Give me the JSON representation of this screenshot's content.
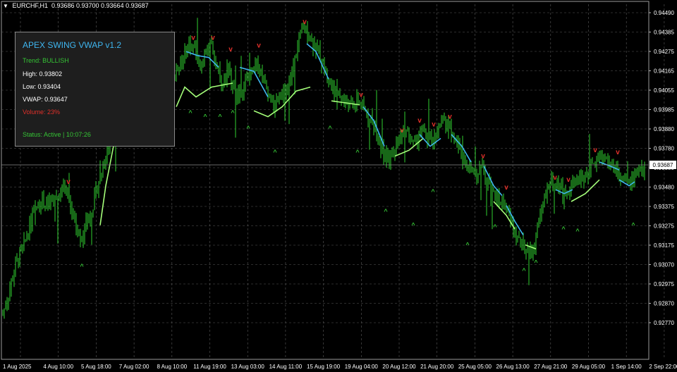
{
  "header": {
    "symbol": "EURCHF,H1",
    "ohlc": "0.93686 0.93700 0.93664 0.93687"
  },
  "panel": {
    "title": "APEX SWING VWAP v1.2",
    "trend": "Trend: BULLISH",
    "high": "High: 0.93802",
    "low": "Low: 0.93404",
    "vwap": "VWAP: 0.93647",
    "volume": "Volume: 23%",
    "status": "Status: Active | 10:07:26",
    "colors": {
      "title": "#3fb6f0",
      "trend": "#35c435",
      "text": "#ffffff",
      "volume": "#e0302a",
      "status": "#35c435",
      "bg": "#1e1e1e",
      "border": "#8a8a8a"
    }
  },
  "price_axis": {
    "labels": [
      "0.94490",
      "0.94385",
      "0.94275",
      "0.94165",
      "0.94055",
      "0.93985",
      "0.93880",
      "0.93780",
      "0.93580",
      "0.93480",
      "0.93375",
      "0.93275",
      "0.93175",
      "0.93070",
      "0.92975",
      "0.92870",
      "0.92770"
    ],
    "current_price": "0.93687"
  },
  "time_axis": {
    "labels": [
      "1 Aug 2025",
      "4 Aug 10:00",
      "5 Aug 18:00",
      "7 Aug 02:00",
      "8 Aug 10:00",
      "11 Aug 19:00",
      "13 Aug 03:00",
      "14 Aug 11:00",
      "15 Aug 19:00",
      "19 Aug 04:00",
      "20 Aug 12:00",
      "21 Aug 20:00",
      "25 Aug 05:00",
      "26 Aug 13:00",
      "27 Aug 21:00",
      "29 Aug 05:00",
      "1 Sep 14:00",
      "2 Sep 22:00"
    ]
  },
  "chart_data": {
    "type": "candlestick",
    "symbol": "EURCHF",
    "timeframe": "H1",
    "ylim": [
      0.9272,
      0.9452
    ],
    "current_price": 0.93687,
    "grid": true,
    "colors": {
      "candles": "#2fd12f",
      "vwap_up": "#3fb6f0",
      "vwap_down": "#a5ff7a",
      "sell_signal": "#e0302a",
      "buy_signal": "#35c435",
      "background": "#000000",
      "grid": "#5a5a5a"
    },
    "close_path": [
      [
        0,
        0.929
      ],
      [
        12,
        0.9305
      ],
      [
        22,
        0.932
      ],
      [
        34,
        0.933
      ],
      [
        46,
        0.9345
      ],
      [
        58,
        0.9352
      ],
      [
        70,
        0.935
      ],
      [
        82,
        0.9355
      ],
      [
        92,
        0.936
      ],
      [
        100,
        0.9348
      ],
      [
        108,
        0.934
      ],
      [
        116,
        0.9332
      ],
      [
        124,
        0.9342
      ],
      [
        132,
        0.935
      ],
      [
        140,
        0.9362
      ],
      [
        148,
        0.9372
      ],
      [
        156,
        0.9382
      ],
      [
        164,
        0.939
      ],
      [
        172,
        0.9396
      ],
      [
        180,
        0.94
      ],
      [
        188,
        0.9398
      ],
      [
        196,
        0.9405
      ],
      [
        204,
        0.9408
      ],
      [
        212,
        0.941
      ],
      [
        220,
        0.9412
      ],
      [
        228,
        0.941
      ],
      [
        236,
        0.9405
      ],
      [
        244,
        0.9412
      ],
      [
        252,
        0.942
      ],
      [
        260,
        0.9425
      ],
      [
        268,
        0.9432
      ],
      [
        276,
        0.943
      ],
      [
        284,
        0.942
      ],
      [
        292,
        0.9428
      ],
      [
        300,
        0.9432
      ],
      [
        308,
        0.942
      ],
      [
        316,
        0.9412
      ],
      [
        324,
        0.9418
      ],
      [
        332,
        0.941
      ],
      [
        340,
        0.9405
      ],
      [
        348,
        0.9412
      ],
      [
        356,
        0.9418
      ],
      [
        364,
        0.9425
      ],
      [
        372,
        0.9415
      ],
      [
        380,
        0.9408
      ],
      [
        388,
        0.94
      ],
      [
        396,
        0.9405
      ],
      [
        404,
        0.9408
      ],
      [
        412,
        0.9415
      ],
      [
        420,
        0.9428
      ],
      [
        428,
        0.9438
      ],
      [
        436,
        0.944
      ],
      [
        444,
        0.9432
      ],
      [
        452,
        0.9428
      ],
      [
        460,
        0.942
      ],
      [
        468,
        0.9412
      ],
      [
        476,
        0.9408
      ],
      [
        484,
        0.9405
      ],
      [
        492,
        0.9402
      ],
      [
        500,
        0.94
      ],
      [
        508,
        0.9403
      ],
      [
        516,
        0.9398
      ],
      [
        524,
        0.9395
      ],
      [
        532,
        0.939
      ],
      [
        540,
        0.938
      ],
      [
        548,
        0.9372
      ],
      [
        556,
        0.9375
      ],
      [
        564,
        0.9383
      ],
      [
        572,
        0.9388
      ],
      [
        580,
        0.9385
      ],
      [
        588,
        0.938
      ],
      [
        596,
        0.9388
      ],
      [
        604,
        0.9385
      ],
      [
        612,
        0.9382
      ],
      [
        620,
        0.9388
      ],
      [
        628,
        0.9393
      ],
      [
        636,
        0.939
      ],
      [
        644,
        0.9385
      ],
      [
        652,
        0.9378
      ],
      [
        660,
        0.9372
      ],
      [
        668,
        0.9368
      ],
      [
        676,
        0.9365
      ],
      [
        684,
        0.937
      ],
      [
        692,
        0.9362
      ],
      [
        700,
        0.9355
      ],
      [
        708,
        0.9352
      ],
      [
        716,
        0.935
      ],
      [
        724,
        0.9342
      ],
      [
        732,
        0.9335
      ],
      [
        740,
        0.933
      ],
      [
        748,
        0.9325
      ],
      [
        756,
        0.9328
      ],
      [
        764,
        0.934
      ],
      [
        772,
        0.9355
      ],
      [
        780,
        0.9362
      ],
      [
        788,
        0.936
      ],
      [
        796,
        0.9358
      ],
      [
        804,
        0.9355
      ],
      [
        812,
        0.936
      ],
      [
        820,
        0.9362
      ],
      [
        828,
        0.9365
      ],
      [
        836,
        0.9368
      ],
      [
        844,
        0.9372
      ],
      [
        852,
        0.9375
      ],
      [
        860,
        0.9373
      ],
      [
        868,
        0.937
      ],
      [
        876,
        0.9365
      ],
      [
        884,
        0.9362
      ],
      [
        892,
        0.9362
      ],
      [
        900,
        0.9365
      ],
      [
        908,
        0.9368
      ],
      [
        915,
        0.9369
      ]
    ],
    "vwap_segments": [
      {
        "color": "#3fb6f0",
        "points": [
          [
            264,
            0.9428
          ],
          [
            280,
            0.9426
          ],
          [
            296,
            0.9425
          ],
          [
            310,
            0.942
          ]
        ]
      },
      {
        "color": "#a5ff7a",
        "points": [
          [
            250,
            0.94
          ],
          [
            262,
            0.941
          ],
          [
            278,
            0.9405
          ],
          [
            300,
            0.941
          ],
          [
            330,
            0.9412
          ]
        ]
      },
      {
        "color": "#3fb6f0",
        "points": [
          [
            340,
            0.942
          ],
          [
            360,
            0.9418
          ],
          [
            380,
            0.9405
          ]
        ]
      },
      {
        "color": "#a5ff7a",
        "points": [
          [
            360,
            0.9398
          ],
          [
            380,
            0.9395
          ],
          [
            400,
            0.94
          ],
          [
            420,
            0.9408
          ],
          [
            440,
            0.941
          ]
        ]
      },
      {
        "color": "#3fb6f0",
        "points": [
          [
            435,
            0.9432
          ],
          [
            448,
            0.9428
          ],
          [
            466,
            0.9414
          ]
        ]
      },
      {
        "color": "#a5ff7a",
        "points": [
          [
            470,
            0.9403
          ],
          [
            490,
            0.9402
          ],
          [
            510,
            0.9401
          ]
        ]
      },
      {
        "color": "#3fb6f0",
        "points": [
          [
            515,
            0.94
          ],
          [
            530,
            0.9393
          ],
          [
            545,
            0.938
          ]
        ]
      },
      {
        "color": "#a5ff7a",
        "points": [
          [
            560,
            0.9375
          ],
          [
            580,
            0.9378
          ],
          [
            600,
            0.9384
          ]
        ]
      },
      {
        "color": "#3fb6f0",
        "points": [
          [
            595,
            0.9386
          ],
          [
            610,
            0.938
          ],
          [
            625,
            0.9384
          ]
        ]
      },
      {
        "color": "#3fb6f0",
        "points": [
          [
            640,
            0.9386
          ],
          [
            655,
            0.938
          ],
          [
            668,
            0.9372
          ]
        ]
      },
      {
        "color": "#3fb6f0",
        "points": [
          [
            686,
            0.937
          ],
          [
            700,
            0.936
          ],
          [
            712,
            0.9355
          ]
        ]
      },
      {
        "color": "#a5ff7a",
        "points": [
          [
            700,
            0.9352
          ],
          [
            718,
            0.9345
          ],
          [
            730,
            0.9338
          ]
        ]
      },
      {
        "color": "#3fb6f0",
        "points": [
          [
            718,
            0.935
          ],
          [
            730,
            0.9342
          ],
          [
            742,
            0.9335
          ]
        ]
      },
      {
        "color": "#a5ff7a",
        "points": [
          [
            745,
            0.933
          ],
          [
            760,
            0.9328
          ]
        ]
      },
      {
        "color": "#3fb6f0",
        "points": [
          [
            788,
            0.9358
          ],
          [
            800,
            0.9356
          ],
          [
            812,
            0.9358
          ]
        ]
      },
      {
        "color": "#a5ff7a",
        "points": [
          [
            810,
            0.9352
          ],
          [
            830,
            0.9356
          ],
          [
            850,
            0.9363
          ]
        ]
      },
      {
        "color": "#3fb6f0",
        "points": [
          [
            850,
            0.9372
          ],
          [
            865,
            0.937
          ],
          [
            878,
            0.9368
          ]
        ]
      },
      {
        "color": "#3fb6f0",
        "points": [
          [
            878,
            0.9363
          ],
          [
            892,
            0.936
          ],
          [
            900,
            0.9362
          ]
        ]
      },
      {
        "color": "#a5ff7a",
        "points": [
          [
            142,
            0.934
          ],
          [
            150,
            0.936
          ],
          [
            162,
            0.9382
          ],
          [
            176,
            0.939
          ],
          [
            190,
            0.9398
          ],
          [
            210,
            0.9405
          ],
          [
            240,
            0.9405
          ]
        ]
      }
    ],
    "sell_signals": [
      [
        97,
        0.9361
      ],
      [
        274,
        0.9434
      ],
      [
        302,
        0.9434
      ],
      [
        327,
        0.9428
      ],
      [
        367,
        0.943
      ],
      [
        432,
        0.9442
      ],
      [
        512,
        0.9405
      ],
      [
        570,
        0.9387
      ],
      [
        595,
        0.9392
      ],
      [
        615,
        0.939
      ],
      [
        638,
        0.9394
      ],
      [
        685,
        0.9374
      ],
      [
        718,
        0.9358
      ],
      [
        787,
        0.9363
      ],
      [
        806,
        0.9362
      ],
      [
        844,
        0.9377
      ],
      [
        876,
        0.9376
      ]
    ],
    "buy_signals": [
      [
        116,
        0.9318
      ],
      [
        270,
        0.9396
      ],
      [
        291,
        0.9394
      ],
      [
        312,
        0.9394
      ],
      [
        330,
        0.9396
      ],
      [
        352,
        0.9388
      ],
      [
        390,
        0.9376
      ],
      [
        468,
        0.9388
      ],
      [
        507,
        0.9376
      ],
      [
        547,
        0.9346
      ],
      [
        586,
        0.9339
      ],
      [
        614,
        0.9356
      ],
      [
        663,
        0.9329
      ],
      [
        702,
        0.9338
      ],
      [
        743,
        0.9316
      ],
      [
        760,
        0.932
      ],
      [
        799,
        0.9337
      ],
      [
        819,
        0.9336
      ],
      [
        898,
        0.9339
      ]
    ]
  }
}
